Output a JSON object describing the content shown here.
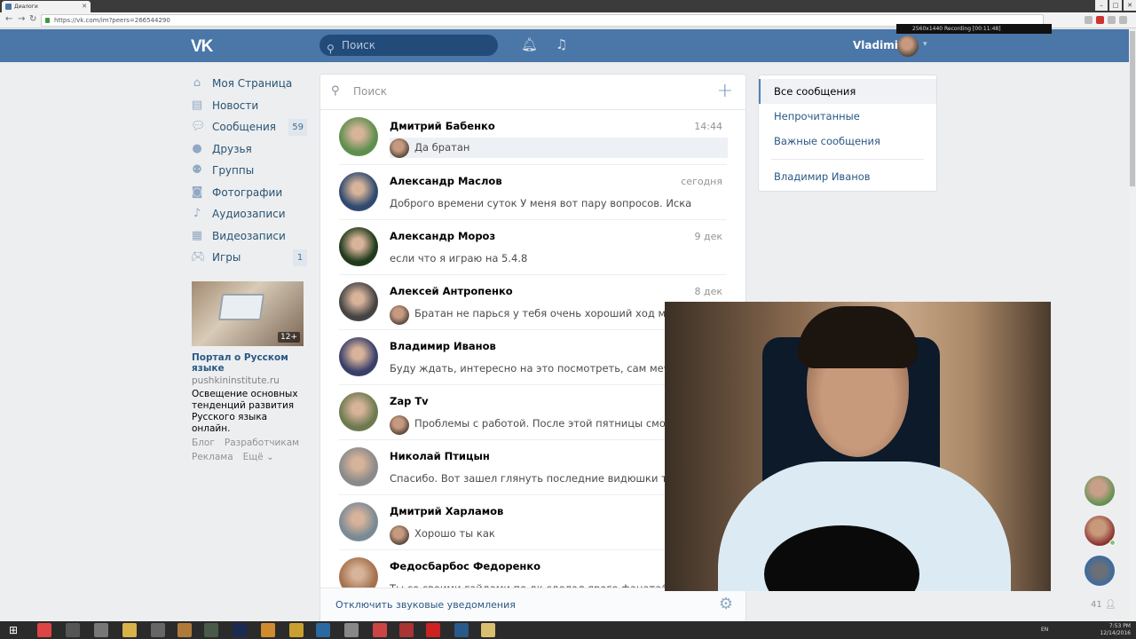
{
  "browser": {
    "tab_title": "Диалоги",
    "url": "https://vk.com/im?peers=266544290",
    "recording_text": "2560x1440     Recording [00:11:48]"
  },
  "header": {
    "search_placeholder": "Поиск",
    "user_name": "Vladimir"
  },
  "left_nav": [
    {
      "label": "Моя Страница",
      "icon": "home-icon",
      "count": ""
    },
    {
      "label": "Новости",
      "icon": "news-icon",
      "count": ""
    },
    {
      "label": "Сообщения",
      "icon": "messages-icon",
      "count": "59"
    },
    {
      "label": "Друзья",
      "icon": "friend-icon",
      "count": ""
    },
    {
      "label": "Группы",
      "icon": "groups-icon",
      "count": ""
    },
    {
      "label": "Фотографии",
      "icon": "photo-icon",
      "count": ""
    },
    {
      "label": "Аудиозаписи",
      "icon": "music-icon",
      "count": ""
    },
    {
      "label": "Видеозаписи",
      "icon": "video-icon",
      "count": ""
    },
    {
      "label": "Игры",
      "icon": "gamepad-icon",
      "count": "1"
    }
  ],
  "promo": {
    "age": "12+",
    "title": "Портал о Русском языке",
    "domain": "pushkininstitute.ru",
    "description": "Освещение основных тенденций развития Русского языка онлайн."
  },
  "footer": {
    "blog": "Блог",
    "developers": "Разработчикам",
    "ads": "Реклама",
    "more": "Ещё ⌄"
  },
  "dialogs": {
    "search_placeholder": "Поиск",
    "rows": [
      {
        "name": "Дмитрий Бабенко",
        "time": "14:44",
        "text": "Да братан",
        "mini": true,
        "unread": true,
        "ava": "#5e8f4e"
      },
      {
        "name": "Александр Маслов",
        "time": "сегодня",
        "text": "Доброго времени суток У меня вот пару вопросов. Искал я ...",
        "mini": false,
        "unread": false,
        "ava": "#2f4a6e"
      },
      {
        "name": "Александр Мороз",
        "time": "9 дек",
        "text": "если что я играю на 5.4.8",
        "mini": false,
        "unread": false,
        "ava": "#1f3a1c"
      },
      {
        "name": "Алексей Антропенко",
        "time": "8 дек",
        "text": "Братан не парься у тебя очень хороший ход мыслей",
        "mini": true,
        "unread": false,
        "ava": "#444444"
      },
      {
        "name": "Владимир Иванов",
        "time": "",
        "text": "Буду ждать, интересно на это посмотреть, сам мечта. когд",
        "mini": false,
        "unread": false,
        "ava": "#3a3f6a"
      },
      {
        "name": "Zap Tv",
        "time": "",
        "text": "Проблемы с работой. После этой пятницы смогу вздо",
        "mini": true,
        "unread": false,
        "ava": "#6d7a4f"
      },
      {
        "name": "Николай Птицын",
        "time": "",
        "text": "Спасибо. Вот зашел глянуть последние видюшки твои. И",
        "mini": false,
        "unread": false,
        "ava": "#8a8a8a"
      },
      {
        "name": "Дмитрий Харламов",
        "time": "",
        "text": "Хорошо ты как",
        "mini": true,
        "unread": false,
        "ava": "#7a8a95"
      },
      {
        "name": "Федосбарбос Федоренко",
        "time": "",
        "text": "Ты со своими гайдами по дк сделал ярого фаната😁 твои",
        "mini": false,
        "unread": false,
        "ava": "#a5714d"
      }
    ],
    "mute_link": "Отключить звуковые уведомления"
  },
  "filters": {
    "all": "Все сообщения",
    "unread": "Непрочитанные",
    "important": "Важные сообщения",
    "person": "Владимир Иванов"
  },
  "contacts_bar": {
    "count": "41"
  },
  "taskbar": {
    "lang": "EN",
    "time": "7:53 PM",
    "date": "12/14/2016"
  }
}
